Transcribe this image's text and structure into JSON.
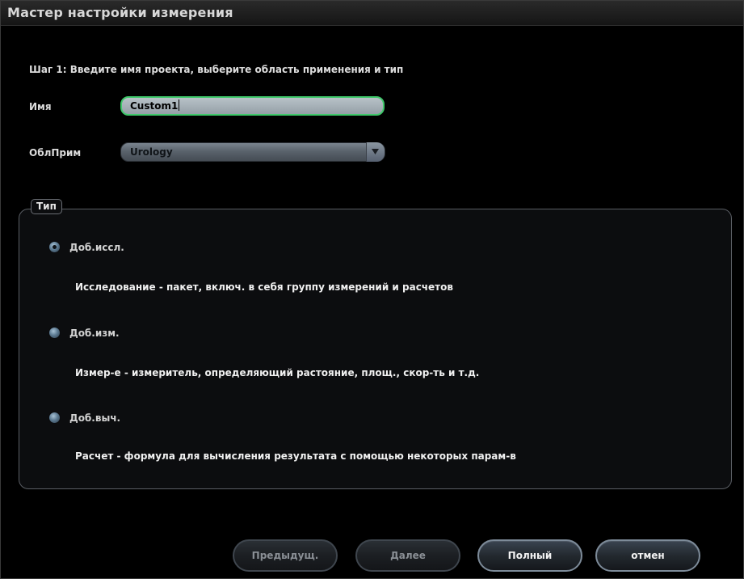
{
  "window": {
    "title": "Мастер настройки измерения"
  },
  "step": {
    "label": "Шаг 1: Введите имя проекта, выберите область применения и тип"
  },
  "fields": {
    "name_label": "Имя",
    "name_value": "Custom1",
    "app_label": "ОблПрим",
    "app_value": "Urology"
  },
  "type_group": {
    "title": "Тип",
    "options": [
      {
        "label": "Доб.иссл.",
        "description": "Исследование - пакет, включ. в себя группу измерений и расчетов",
        "checked": true
      },
      {
        "label": "Доб.изм.",
        "description": "Измер-е - измеритель, определяющий растояние, площ., скор-ть и т.д.",
        "checked": false
      },
      {
        "label": "Доб.выч.",
        "description": "Расчет - формула для вычисления результата с помощью некоторых парам-в",
        "checked": false
      }
    ]
  },
  "buttons": {
    "prev": "Предыдущ.",
    "next": "Далее",
    "full": "Полный",
    "cancel": "отмен"
  },
  "colors": {
    "input_focus_border": "#3fc86a",
    "background": "#000000"
  }
}
